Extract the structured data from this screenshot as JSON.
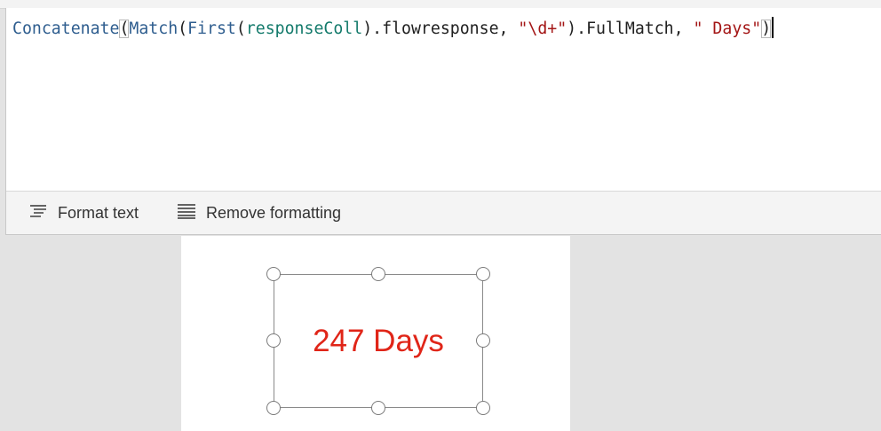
{
  "formula": {
    "fn_concatenate": "Concatenate",
    "paren_open": "(",
    "fn_match": "Match",
    "paren_match_open": "(",
    "fn_first": "First",
    "paren_first_open": "(",
    "var_collection": "responseColl",
    "property_access": ").flowresponse, ",
    "string_pattern": "\"\\d+\"",
    "fullmatch_access": ").FullMatch, ",
    "string_suffix": "\" Days\"",
    "paren_close": ")"
  },
  "toolbar": {
    "format_text_label": "Format text",
    "remove_formatting_label": "Remove formatting"
  },
  "canvas": {
    "label_value": "247 Days"
  },
  "colors": {
    "function": "#2f5e8f",
    "variable": "#137a6b",
    "string": "#a31515",
    "label_text": "#e02518"
  },
  "icons": {
    "format_text": "format-text-icon",
    "remove_formatting": "remove-formatting-icon"
  }
}
